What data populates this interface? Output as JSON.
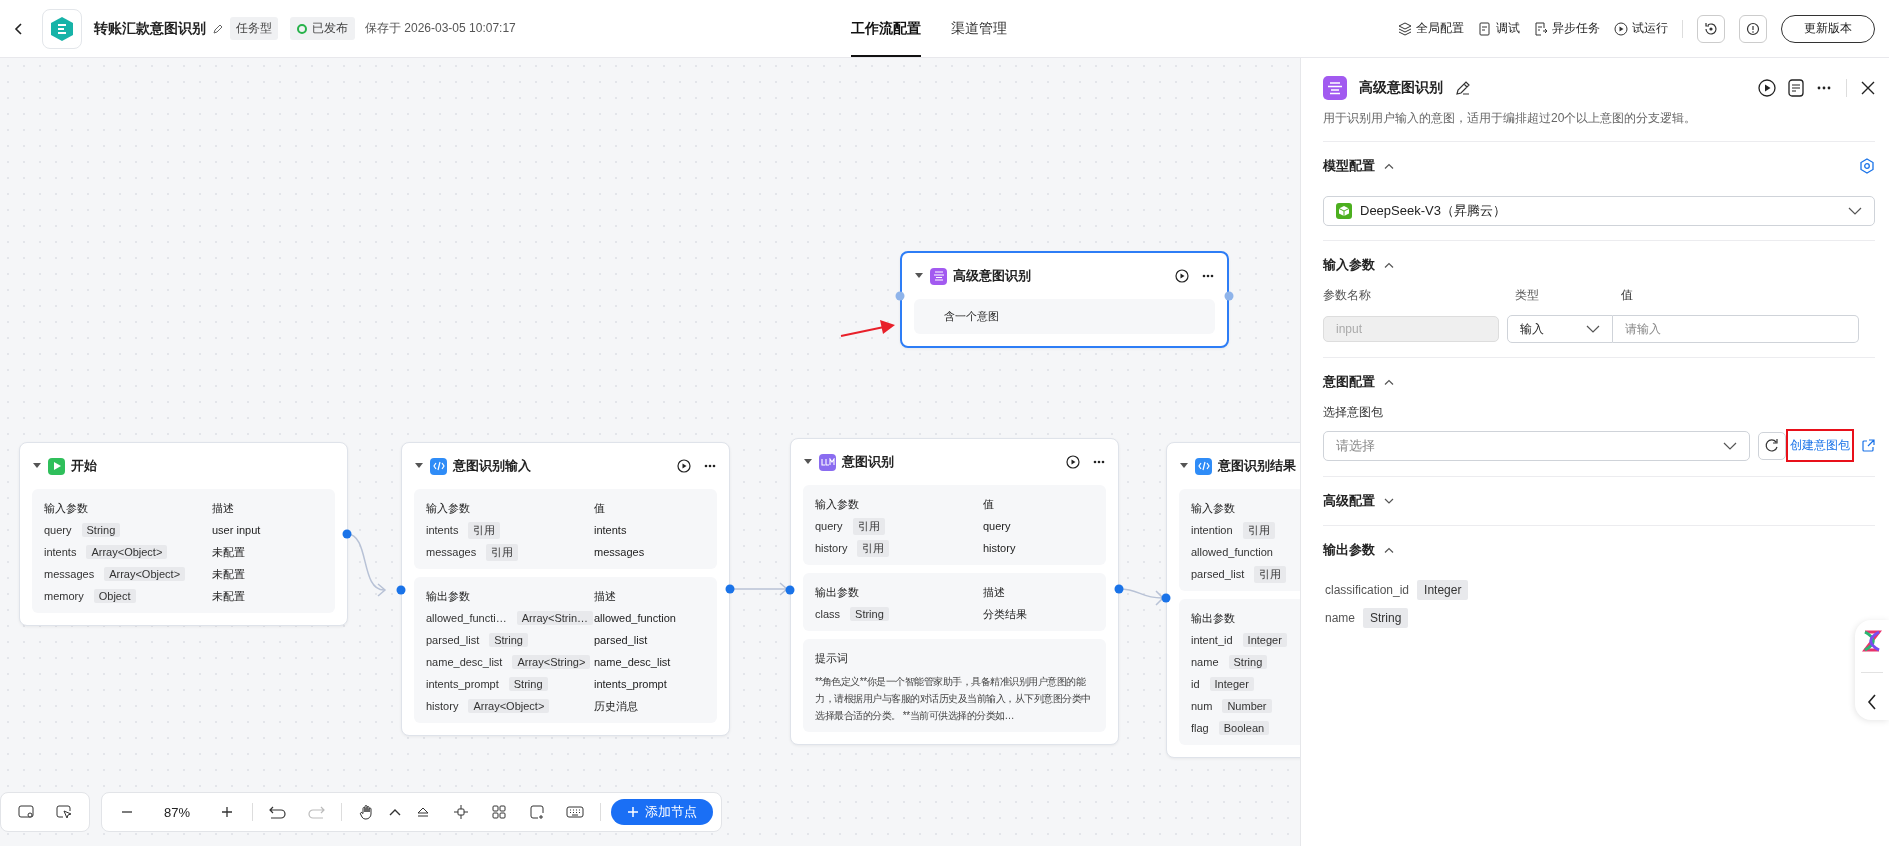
{
  "header": {
    "title": "转账汇款意图识别",
    "type_tag": "任务型",
    "status": "已发布",
    "saved": "保存于 2026-03-05 10:07:17",
    "tabs": [
      {
        "label": "工作流配置",
        "selected": true
      },
      {
        "label": "渠道管理",
        "selected": false
      }
    ],
    "actions": [
      {
        "kind": "global",
        "label": "全局配置"
      },
      {
        "kind": "debug",
        "label": "调试"
      },
      {
        "kind": "async",
        "label": "异步任务"
      },
      {
        "kind": "run",
        "label": "试运行"
      }
    ],
    "update_button": "更新版本"
  },
  "nodes": [
    {
      "kind": "start",
      "title": "开始",
      "selected": false,
      "run_button": false,
      "sections": [
        {
          "kind": "params",
          "heads": [
            "输入参数",
            "描述"
          ],
          "rows": [
            {
              "name": "query",
              "type": "String",
              "value": "user input"
            },
            {
              "name": "intents",
              "type": "Array<Object>",
              "value": "未配置"
            },
            {
              "name": "messages",
              "type": "Array<Object>",
              "value": "未配置"
            },
            {
              "name": "memory",
              "type": "Object",
              "value": "未配置"
            }
          ]
        }
      ]
    },
    {
      "kind": "code",
      "title": "意图识别输入",
      "selected": false,
      "run_button": true,
      "sections": [
        {
          "kind": "params",
          "heads": [
            "输入参数",
            "值"
          ],
          "rows": [
            {
              "name": "intents",
              "type": "引用",
              "value": "intents"
            },
            {
              "name": "messages",
              "type": "引用",
              "value": "messages"
            }
          ]
        },
        {
          "kind": "params",
          "heads": [
            "输出参数",
            "描述"
          ],
          "rows": [
            {
              "name": "allowed_functi…",
              "type": "Array<Strin…",
              "value": "allowed_function"
            },
            {
              "name": "parsed_list",
              "type": "String",
              "value": "parsed_list"
            },
            {
              "name": "name_desc_list",
              "type": "Array<String>",
              "value": "name_desc_list"
            },
            {
              "name": "intents_prompt",
              "type": "String",
              "value": "intents_prompt"
            },
            {
              "name": "history",
              "type": "Array<Object>",
              "value": "历史消息"
            }
          ]
        }
      ]
    },
    {
      "kind": "llm",
      "title": "意图识别",
      "selected": false,
      "run_button": true,
      "sections": [
        {
          "kind": "params",
          "heads": [
            "输入参数",
            "值"
          ],
          "rows": [
            {
              "name": "query",
              "type": "引用",
              "value": "query"
            },
            {
              "name": "history",
              "type": "引用",
              "value": "history"
            }
          ]
        },
        {
          "kind": "params",
          "heads": [
            "输出参数",
            "描述"
          ],
          "rows": [
            {
              "name": "class",
              "type": "String",
              "value": "分类结果"
            }
          ]
        },
        {
          "kind": "prompt",
          "title": "提示词",
          "text": "**角色定义**你是一个智能管家助手，具备精准识别用户意图的能力，请根据用户与客服的对话历史及当前输入，从下列意图分类中选择最合适的分类。 **当前可供选择的分类如…"
        }
      ]
    },
    {
      "kind": "code",
      "title": "意图识别结果",
      "selected": false,
      "run_button": false,
      "sections": [
        {
          "kind": "params",
          "heads": [
            "输入参数"
          ],
          "rows": [
            {
              "name": "intention",
              "type": "引用"
            },
            {
              "name": "allowed_function"
            },
            {
              "name": "parsed_list",
              "type": "引用"
            }
          ]
        },
        {
          "kind": "params",
          "heads": [
            "输出参数"
          ],
          "rows": [
            {
              "name": "intent_id",
              "type": "Integer"
            },
            {
              "name": "name",
              "type": "String"
            },
            {
              "name": "id",
              "type": "Integer"
            },
            {
              "name": "num",
              "type": "Number"
            },
            {
              "name": "flag",
              "type": "Boolean"
            }
          ]
        }
      ]
    },
    {
      "kind": "intent",
      "title": "高级意图识别",
      "selected": true,
      "run_button": true,
      "sections": [
        {
          "kind": "text",
          "text": "含一个意图"
        }
      ]
    }
  ],
  "toolbar": {
    "zoom": "87%",
    "add_button": "添加节点"
  },
  "panel": {
    "title": "高级意图识别",
    "description": "用于识别用户输入的意图，适用于编排超过20个以上意图的分支逻辑。",
    "sections": [
      {
        "kind": "model",
        "title": "模型配置",
        "expanded": true,
        "model": "DeepSeek-V3（昇腾云）"
      },
      {
        "kind": "inputs",
        "title": "输入参数",
        "expanded": true,
        "columns": [
          "参数名称",
          "类型",
          "值"
        ],
        "rows": [
          {
            "name": "input",
            "disabled": true,
            "type": "输入",
            "placeholder": "请输入"
          }
        ]
      },
      {
        "kind": "intent",
        "title": "意图配置",
        "expanded": true,
        "label": "选择意图包",
        "placeholder": "请选择",
        "link": "创建意图包",
        "highlighted": true
      },
      {
        "kind": "advanced",
        "title": "高级配置",
        "expanded": false
      },
      {
        "kind": "outputs",
        "title": "输出参数",
        "expanded": true,
        "rows": [
          {
            "name": "classification_id",
            "type": "Integer"
          },
          {
            "name": "name",
            "type": "String"
          }
        ]
      }
    ]
  }
}
